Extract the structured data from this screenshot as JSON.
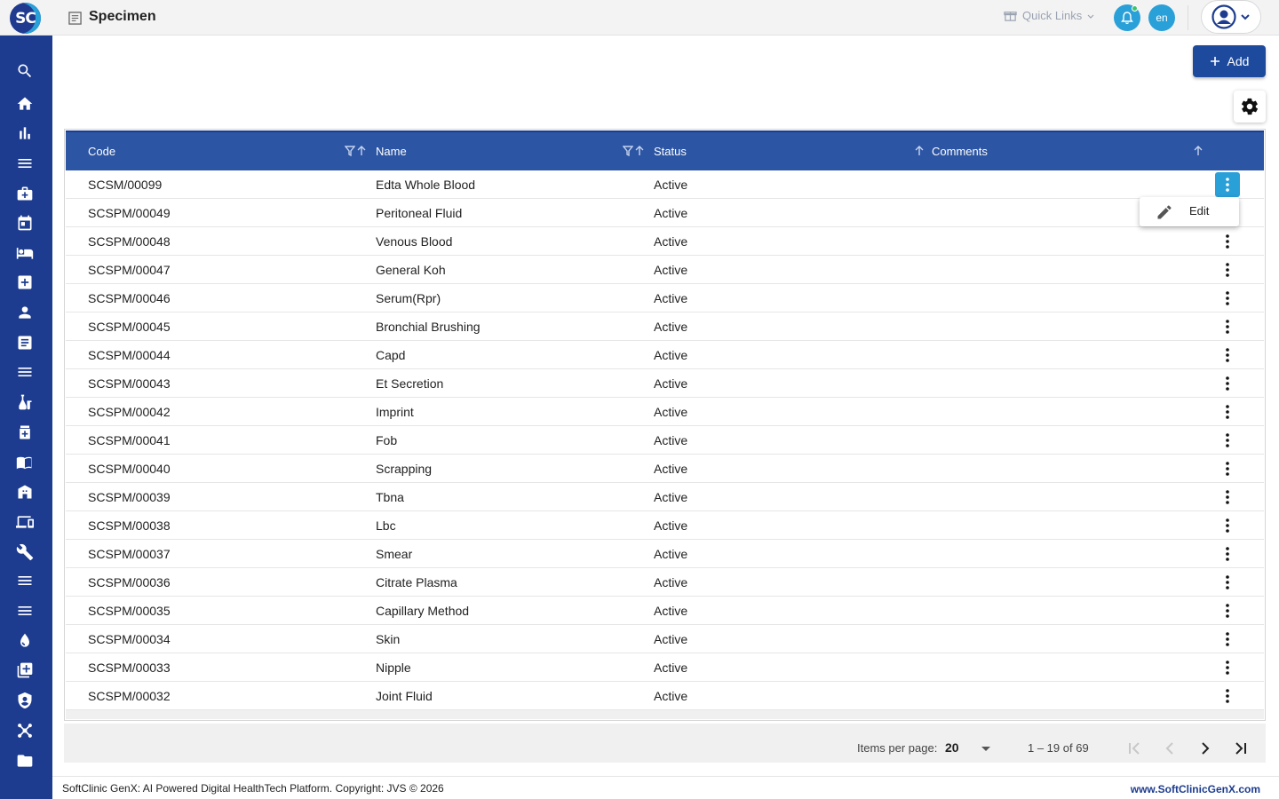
{
  "app": {
    "logo_text": "SC",
    "page_title": "Specimen"
  },
  "header": {
    "quick_links_label": "Quick Links",
    "language": "en"
  },
  "toolbar": {
    "add_label": "Add"
  },
  "table": {
    "columns": {
      "code": "Code",
      "name": "Name",
      "status": "Status",
      "comments": "Comments"
    },
    "rows": [
      {
        "code": "SCSM/00099",
        "name": "Edta Whole Blood",
        "status": "Active"
      },
      {
        "code": "SCSPM/00049",
        "name": "Peritoneal Fluid",
        "status": "Active"
      },
      {
        "code": "SCSPM/00048",
        "name": "Venous Blood",
        "status": "Active"
      },
      {
        "code": "SCSPM/00047",
        "name": "General Koh",
        "status": "Active"
      },
      {
        "code": "SCSPM/00046",
        "name": "Serum(Rpr)",
        "status": "Active"
      },
      {
        "code": "SCSPM/00045",
        "name": "Bronchial Brushing",
        "status": "Active"
      },
      {
        "code": "SCSPM/00044",
        "name": "Capd",
        "status": "Active"
      },
      {
        "code": "SCSPM/00043",
        "name": "Et Secretion",
        "status": "Active"
      },
      {
        "code": "SCSPM/00042",
        "name": "Imprint",
        "status": "Active"
      },
      {
        "code": "SCSPM/00041",
        "name": "Fob",
        "status": "Active"
      },
      {
        "code": "SCSPM/00040",
        "name": "Scrapping",
        "status": "Active"
      },
      {
        "code": "SCSPM/00039",
        "name": "Tbna",
        "status": "Active"
      },
      {
        "code": "SCSPM/00038",
        "name": "Lbc",
        "status": "Active"
      },
      {
        "code": "SCSPM/00037",
        "name": "Smear",
        "status": "Active"
      },
      {
        "code": "SCSPM/00036",
        "name": "Citrate Plasma",
        "status": "Active"
      },
      {
        "code": "SCSPM/00035",
        "name": "Capillary Method",
        "status": "Active"
      },
      {
        "code": "SCSPM/00034",
        "name": "Skin",
        "status": "Active"
      },
      {
        "code": "SCSPM/00033",
        "name": "Nipple",
        "status": "Active"
      },
      {
        "code": "SCSPM/00032",
        "name": "Joint Fluid",
        "status": "Active"
      }
    ]
  },
  "row_menu": {
    "edit_label": "Edit"
  },
  "paginator": {
    "items_per_page_label": "Items per page:",
    "items_per_page": "20",
    "range_label": "1 – 19 of 69"
  },
  "footer": {
    "copyright": "SoftClinic GenX: AI Powered Digital HealthTech Platform. Copyright: JVS © 2026",
    "website": "www.SoftClinicGenX.com"
  },
  "sidebar_icons": [
    "search-icon",
    "home-icon",
    "bar-chart-icon",
    "menu-icon",
    "medical-bag-icon",
    "calendar-icon",
    "bed-icon",
    "medical-plus-icon",
    "person-icon",
    "document-list-icon",
    "menu-icon",
    "lab-flask-icon",
    "pharmacy-icon",
    "book-icon",
    "store-icon",
    "devices-icon",
    "wrench-icon",
    "menu-icon",
    "menu-icon",
    "blood-drop-icon",
    "add-box-icon",
    "shield-icon",
    "molecule-icon",
    "folder-icon"
  ],
  "colors": {
    "primary": "#1d3c8f",
    "header": "#2c55a4",
    "accent": "#2aa0d8"
  }
}
